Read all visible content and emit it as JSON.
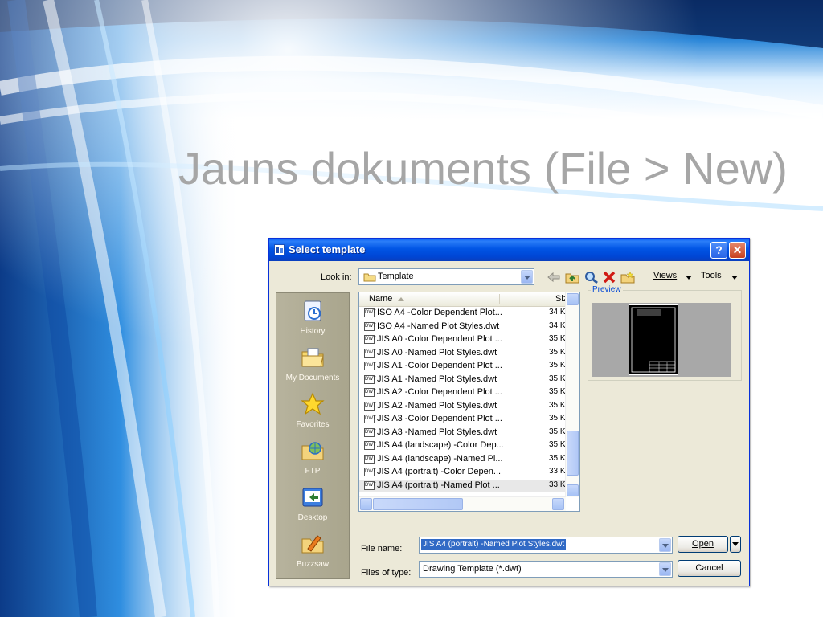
{
  "slide": {
    "title": "Jauns dokuments (File > New)"
  },
  "dialog": {
    "title": "Select template",
    "help_glyph": "?",
    "close_glyph": "✕",
    "look_in_label": "Look in:",
    "look_in_value": "Template",
    "toolbar": {
      "views_label": "Views",
      "tools_label": "Tools",
      "icons": [
        "back-icon",
        "up-folder-icon",
        "search-web-icon",
        "delete-icon",
        "new-folder-icon"
      ]
    },
    "places": [
      {
        "label": "History",
        "icon": "history-icon"
      },
      {
        "label": "My Documents",
        "icon": "my-documents-icon"
      },
      {
        "label": "Favorites",
        "icon": "favorites-icon"
      },
      {
        "label": "FTP",
        "icon": "ftp-icon"
      },
      {
        "label": "Desktop",
        "icon": "desktop-icon"
      },
      {
        "label": "Buzzsaw",
        "icon": "buzzsaw-icon"
      }
    ],
    "columns": {
      "name": "Name",
      "size": "Siz"
    },
    "file_icon_text": "DWT",
    "files": [
      {
        "name": "ISO A4 -Color Dependent Plot...",
        "size": "34 K"
      },
      {
        "name": "ISO A4 -Named Plot Styles.dwt",
        "size": "34 K"
      },
      {
        "name": "JIS A0 -Color Dependent Plot ...",
        "size": "35 K"
      },
      {
        "name": "JIS A0 -Named Plot Styles.dwt",
        "size": "35 K"
      },
      {
        "name": "JIS A1 -Color Dependent Plot ...",
        "size": "35 K"
      },
      {
        "name": "JIS A1 -Named Plot Styles.dwt",
        "size": "35 K"
      },
      {
        "name": "JIS A2 -Color Dependent Plot ...",
        "size": "35 K"
      },
      {
        "name": "JIS A2 -Named Plot Styles.dwt",
        "size": "35 K"
      },
      {
        "name": "JIS A3 -Color Dependent Plot ...",
        "size": "35 K"
      },
      {
        "name": "JIS A3 -Named Plot Styles.dwt",
        "size": "35 K"
      },
      {
        "name": "JIS A4 (landscape) -Color Dep...",
        "size": "35 K"
      },
      {
        "name": "JIS A4 (landscape) -Named Pl...",
        "size": "35 K"
      },
      {
        "name": "JIS A4 (portrait) -Color Depen...",
        "size": "33 K"
      },
      {
        "name": "JIS A4 (portrait) -Named Plot ...",
        "size": "33 K"
      }
    ],
    "selected_index": 13,
    "preview_label": "Preview",
    "file_name_label": "File name:",
    "file_name_value": "JIS A4 (portrait) -Named Plot Styles.dwt",
    "files_of_type_label": "Files of type:",
    "files_of_type_value": "Drawing Template (*.dwt)",
    "open_label": "Open",
    "cancel_label": "Cancel",
    "colors": {
      "titlebar": "#0055e5",
      "dialog_bg": "#ece9d8",
      "places_bg": "#b0ac95",
      "selection": "#316ac5"
    }
  }
}
